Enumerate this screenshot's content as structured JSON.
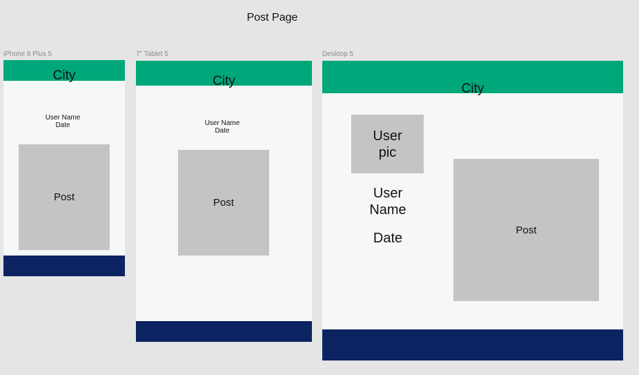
{
  "page": {
    "title": "Post Page"
  },
  "colors": {
    "canvas": "#e5e5e5",
    "frame": "#f6f8f8",
    "header": "#00a77a",
    "footer": "#0c2362",
    "placeholder": "#c4c4c4"
  },
  "frames": {
    "iphone": {
      "label": "iPhone 8 Plus 5",
      "city": "City",
      "user_name": "User Name",
      "date": "Date",
      "post": "Post"
    },
    "tablet": {
      "label": "7\" Tablet 5",
      "city": "City",
      "user_name": "User Name",
      "date": "Date",
      "post": "Post"
    },
    "desktop": {
      "label": "Desktop 5",
      "city": "City",
      "user_pic_line1": "User",
      "user_pic_line2": "pic",
      "user_name_line1": "User",
      "user_name_line2": "Name",
      "date": "Date",
      "post": "Post"
    }
  }
}
